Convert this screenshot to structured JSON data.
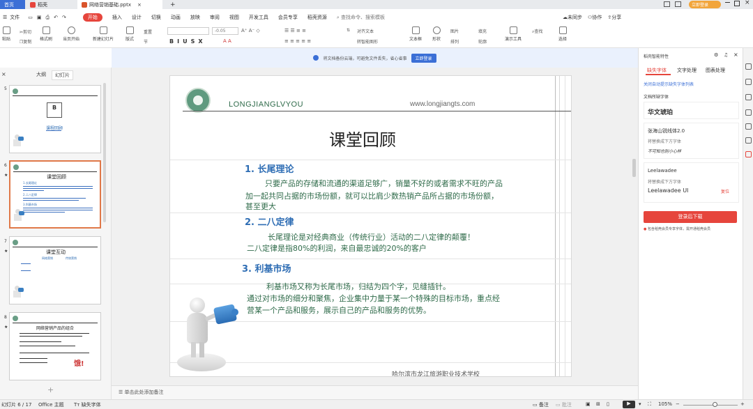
{
  "tabs": {
    "home": "首页",
    "stick": "稻壳",
    "file": "网络营销基础.pptx",
    "add": "+"
  },
  "topright": {
    "login": "立即登录"
  },
  "menu": {
    "items": [
      "文件",
      "开始",
      "插入",
      "设计",
      "切换",
      "动画",
      "放映",
      "审阅",
      "视图",
      "开发工具",
      "会员专享",
      "稻壳资源"
    ],
    "search": "查找命令、搜索模板",
    "sync": "未同步",
    "collab": "协作",
    "share": "分享"
  },
  "ribbon": {
    "format_painter": "格式刷",
    "paste": "粘贴",
    "cut": "剪切",
    "copy": "复制",
    "from_current": "当页开始",
    "new_slide": "新建幻灯片",
    "layout": "版式",
    "section": "节",
    "reset": "重置",
    "font_size": "-0.05",
    "text_box": "文本框",
    "shape": "形状",
    "arrange": "排列",
    "outline": "轮廓",
    "presenter": "演示工具",
    "find": "查找",
    "select": "选择",
    "convert": "转智能图形",
    "align_text": "对齐文本",
    "picture": "图片",
    "fill": "填充"
  },
  "notification": {
    "text": "将文档备份云端，可避免文件丢失，省心省事",
    "button": "立即登录"
  },
  "left": {
    "tab_outline": "大纲",
    "tab_slides": "幻灯片",
    "add": "+"
  },
  "thumbs": [
    {
      "num": "5",
      "letter": "B",
      "caption": "课程回顾"
    },
    {
      "num": "6",
      "title": "课堂回顾",
      "h1": "1.长尾理论",
      "h2": "2.二八定律",
      "h3": "3.利基市场"
    },
    {
      "num": "7",
      "title": "课堂互动",
      "t1": "网络营销",
      "t2": "传统营销"
    },
    {
      "num": "8",
      "title": "网络营销产品的组合",
      "big": "饿!"
    }
  ],
  "slide": {
    "header_left": "LONGJIANGLVYOU",
    "header_right": "www.longjiangts.com",
    "title": "课堂回顾",
    "s1_heading": "1. 长尾理论",
    "s1_l1": "只要产品的存储和流通的渠道足够广，销量不好的或者需求不旺的产品",
    "s1_l2": "加一起共同占据的市场份额，就可以比肩少数热销产品所占据的市场份额，",
    "s1_l3": "甚至更大",
    "s2_heading": "2. 二八定律",
    "s2_l1": "长尾理论是对经典商业（传统行业）活动的二八定律的颠覆！",
    "s2_l2": "二八定律是指80%的利润，来自最忠诚的20%的客户",
    "s3_heading": "3. 利基市场",
    "s3_l1": "利基市场又称为长尾市场，归结为四个字，见缝插针。",
    "s3_l2": "通过对市场的细分和聚焦，企业集中力量于某一个特殊的目标市场，重点经",
    "s3_l3": "营某一个产品和服务，展示自己的产品和服务的优势。",
    "footer": "哈尔滨市龙江旅游职业技术学校"
  },
  "notes": {
    "placeholder": "单击此处添加备注"
  },
  "right": {
    "header": "稻壳智能特性",
    "tabs": [
      "缺失字体",
      "文字处理",
      "图表处理"
    ],
    "link": "关闭自动提示缺失字体列表",
    "section": "文档所缺字体",
    "f1": "华文琥珀",
    "f2_name": "张海山锐线体2.0",
    "f2_hint": "将替换成下方字体",
    "f2_sample": "不可知也别小心样",
    "f3_name": "Leelawadee",
    "f3_hint": "将替换成下方字体",
    "f3_sub": "Leelawadee UI",
    "f3_status": "复位",
    "download": "登录后下载",
    "member_note": "包含稻壳会员专享字体，需开通稻壳会员"
  },
  "status": {
    "slide_count": "幻灯片 6 / 17",
    "theme": "Office 主题",
    "missing_font": "缺失字体",
    "notes": "备注",
    "comment": "批注",
    "zoom": "105%"
  },
  "colors": {
    "accent_red": "#e6453c",
    "slide_blue": "#2e6db4",
    "slide_green": "#2f6b4a",
    "wps_blue": "#3b6fd6"
  }
}
